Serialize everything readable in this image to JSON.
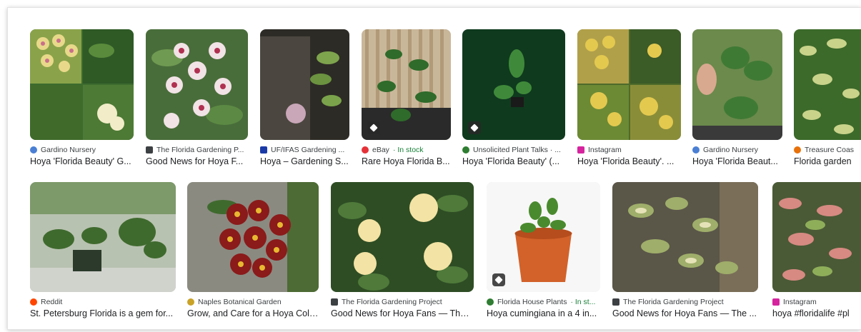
{
  "results": {
    "row1": [
      {
        "source": "Gardino Nursery",
        "title": "Hoya 'Florida Beauty' G...",
        "favicon_color": "#4a7fd4",
        "favicon_icon": "globe-icon"
      },
      {
        "source": "The Florida Gardening P...",
        "title": "Good News for Hoya F...",
        "favicon_color": "#3c4043",
        "favicon_icon": "cube-icon"
      },
      {
        "source": "UF/IFAS Gardening ...",
        "title": "Hoya – Gardening S...",
        "favicon_color": "#1a3aa8",
        "favicon_icon": "uf-logo-icon"
      },
      {
        "source": "eBay",
        "stock": "· In stock",
        "title": "Rare Hoya Florida B...",
        "favicon_color": "#e53238",
        "favicon_icon": "ebay-icon",
        "badge": "shopping-tag-icon"
      },
      {
        "source": "Unsolicited Plant Talks · ...",
        "title": "Hoya 'Florida Beauty' (...",
        "favicon_color": "#2e7d32",
        "favicon_icon": "leaf-icon",
        "badge": "shopping-tag-icon"
      },
      {
        "source": "Instagram",
        "title": "Hoya 'Florida Beauty'. ...",
        "favicon_color": "#d6249f",
        "favicon_icon": "instagram-icon"
      },
      {
        "source": "Gardino Nursery",
        "title": "Hoya 'Florida Beaut...",
        "favicon_color": "#4a7fd4",
        "favicon_icon": "globe-icon"
      },
      {
        "source": "Treasure Coas",
        "title": "Florida garden",
        "favicon_color": "#e8710a",
        "favicon_icon": "globe-icon"
      }
    ],
    "row2": [
      {
        "source": "Reddit",
        "title": "St. Petersburg Florida is a gem for...",
        "favicon_color": "#ff4500",
        "favicon_icon": "reddit-icon"
      },
      {
        "source": "Naples Botanical Garden",
        "title": "Grow, and Care for a Hoya Coll...",
        "favicon_color": "#c9a227",
        "favicon_icon": "leaf-icon"
      },
      {
        "source": "The Florida Gardening Project",
        "title": "Good News for Hoya Fans — The ...",
        "favicon_color": "#3c4043",
        "favicon_icon": "cube-icon"
      },
      {
        "source": "Florida House Plants",
        "stock": "· In st...",
        "title": "Hoya cumingiana in a 4 in...",
        "favicon_color": "#2e7d32",
        "favicon_icon": "plant-icon",
        "badge": "shopping-tag-icon"
      },
      {
        "source": "The Florida Gardening Project",
        "title": "Good News for Hoya Fans — The ...",
        "favicon_color": "#3c4043",
        "favicon_icon": "cube-icon"
      },
      {
        "source": "Instagram",
        "title": "hoya #floridalife #pl",
        "favicon_color": "#d6249f",
        "favicon_icon": "instagram-icon"
      }
    ]
  }
}
